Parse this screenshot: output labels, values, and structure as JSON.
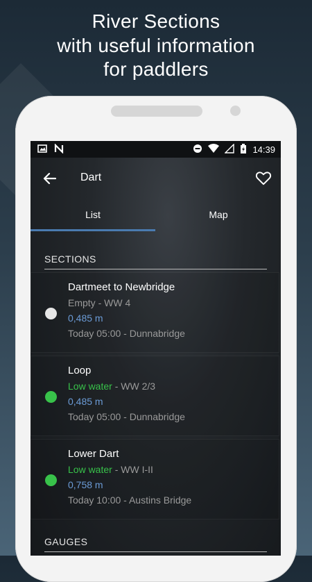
{
  "headline": {
    "line1": "River Sections",
    "line2": "with useful information",
    "line3": "for paddlers"
  },
  "statusbar": {
    "time": "14:39"
  },
  "toolbar": {
    "title": "Dart"
  },
  "tabs": [
    {
      "label": "List",
      "active": true
    },
    {
      "label": "Map",
      "active": false
    }
  ],
  "sections_header": "SECTIONS",
  "sections": [
    {
      "name": "Dartmeet to Newbridge",
      "state": "Empty",
      "grade": " - WW 4",
      "level": "0,485 m",
      "time": "Today 05:00 - Dunnabridge",
      "dot_color": "#e6e6e6",
      "state_color": "#9a9a9a"
    },
    {
      "name": "Loop",
      "state": "Low water",
      "grade": " - WW 2/3",
      "level": "0,485 m",
      "time": "Today 05:00 - Dunnabridge",
      "dot_color": "#38c24a",
      "state_color": "#38c24a"
    },
    {
      "name": "Lower Dart",
      "state": "Low water",
      "grade": " - WW I-II",
      "level": "0,758 m",
      "time": "Today 10:00 - Austins Bridge",
      "dot_color": "#38c24a",
      "state_color": "#38c24a"
    }
  ],
  "gauges_header": "GAUGES",
  "colors": {
    "accent": "#4a7bb0",
    "low_water": "#38c24a",
    "level": "#6b9bd6"
  }
}
